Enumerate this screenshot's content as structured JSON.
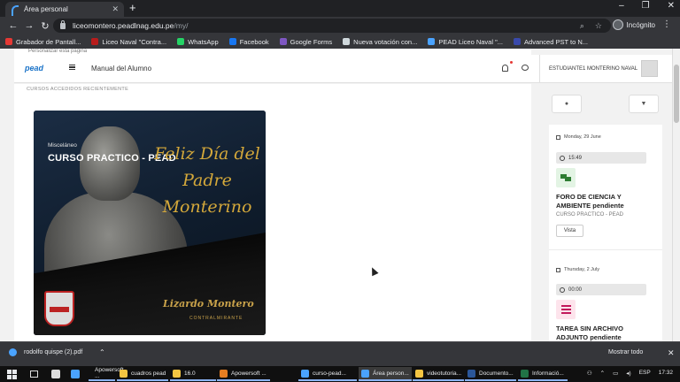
{
  "browser": {
    "tab_title": "Área personal",
    "url_host": "liceomontero.peadlnag.edu.pe",
    "url_path": "/my/",
    "profile_label": "Incógnito",
    "bookmarks": [
      {
        "label": "Grabador de Pantall...",
        "color": "#e53935"
      },
      {
        "label": "Liceo Naval \"Contra...",
        "color": "#b71c1c"
      },
      {
        "label": "WhatsApp",
        "color": "#25d366"
      },
      {
        "label": "Facebook",
        "color": "#1877f2"
      },
      {
        "label": "Google Forms",
        "color": "#7e57c2"
      },
      {
        "label": "Nueva votación con...",
        "color": "#cfd8dc"
      },
      {
        "label": "PEAD Liceo Naval \"...",
        "color": "#4aa3ff"
      },
      {
        "label": "Advanced PST to N...",
        "color": "#3949ab"
      }
    ]
  },
  "moodle": {
    "customize_label": "Personalizar esta página",
    "site_title": "Manual del Alumno",
    "user_name": "ESTUDIANTE1 MONTERINO NAVAL",
    "section_label": "CURSOS ACCEDIDOS RECIENTEMENTE",
    "course_card": {
      "category": "Misceláneo",
      "course_name": "CURSO PRACTICO - PEAD",
      "greeting": "Feliz Día del Padre Monterino",
      "signature": "Lizardo Montero",
      "signature_sub": "CONTRALMIRANTE"
    },
    "timeline": {
      "events": [
        {
          "date": "Monday, 29 June",
          "time": "15:49",
          "title": "FORO DE CIENCIA Y AMBIENTE pendiente",
          "course": "CURSO PRACTICO - PEAD",
          "action": "Vista",
          "icon": "forum-icon",
          "tile_color": "#e3f4e4"
        },
        {
          "date": "Thursday, 2 July",
          "time": "00:00",
          "title": "TAREA SIN ARCHIVO ADJUNTO pendiente",
          "icon": "assignment-icon",
          "tile_color": "#fde4ec"
        }
      ]
    }
  },
  "downloads": {
    "file_name": "rodolfo quispe (2).pdf",
    "show_all": "Mostrar todo"
  },
  "taskbar": {
    "items": [
      {
        "label": "Apowersoft ...",
        "color": "#e67e22"
      },
      {
        "label": "cuadros pead",
        "color": "#f4c542"
      },
      {
        "label": "16.0",
        "color": "#f4c542"
      },
      {
        "label": "Apowersoft ...",
        "color": "#e67e22"
      },
      {
        "label": "curso-pead...",
        "color": "#4aa3ff"
      },
      {
        "label": "Área person...",
        "color": "#4aa3ff",
        "active": true
      },
      {
        "label": "videotutoria...",
        "color": "#f4c542"
      },
      {
        "label": "Documento...",
        "color": "#2b579a"
      },
      {
        "label": "Informació...",
        "color": "#217346"
      }
    ],
    "language": "ESP",
    "clock": "17:32"
  }
}
